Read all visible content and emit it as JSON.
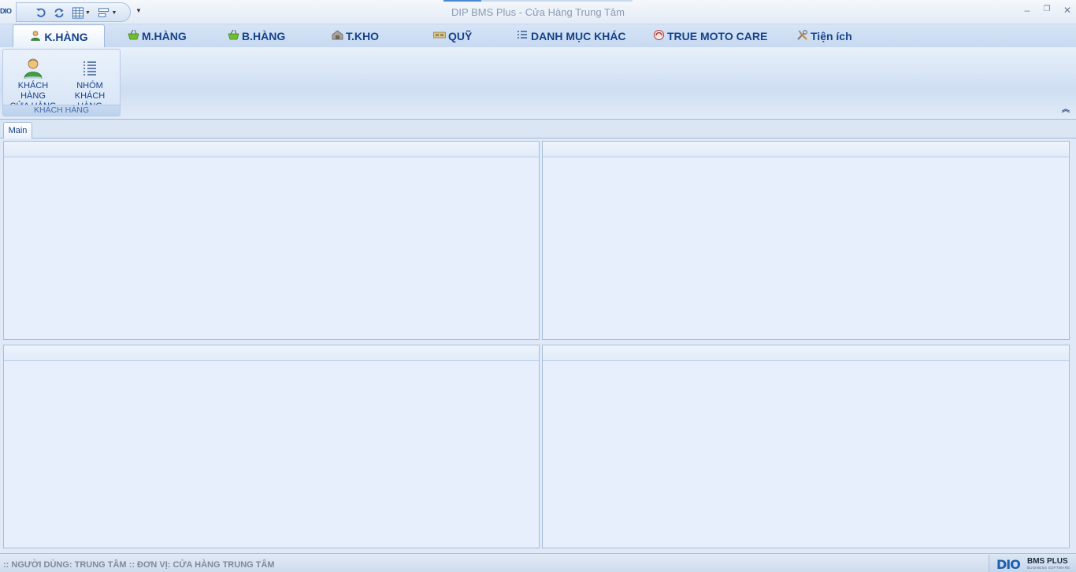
{
  "titlebar": {
    "app_logo_text": "DIO",
    "window_title": "DIP BMS Plus - Cửa Hàng Trung Tâm",
    "quick_access": [
      {
        "icon": "undo-icon"
      },
      {
        "icon": "refresh-icon"
      },
      {
        "icon": "grid-layout-icon"
      },
      {
        "icon": "list-layout-icon"
      }
    ],
    "controls": {
      "minimize": "–",
      "restore": "❐",
      "close": "✕"
    }
  },
  "ribbon": {
    "tabs": [
      {
        "label": "K.HÀNG",
        "icon": "customer-icon",
        "active": true
      },
      {
        "label": "M.HÀNG",
        "icon": "basket-icon"
      },
      {
        "label": "B.HÀNG",
        "icon": "basket-icon"
      },
      {
        "label": "T.KHO",
        "icon": "warehouse-icon"
      },
      {
        "label": "QUỸ",
        "icon": "cash-icon"
      },
      {
        "label": "DANH MỤC KHÁC",
        "icon": "list-icon"
      },
      {
        "label": "TRUE MOTO CARE",
        "icon": "moto-care-icon"
      },
      {
        "label": "Tiện ích",
        "icon": "tools-icon"
      }
    ],
    "group": {
      "caption": "KHÁCH HÀNG",
      "buttons": [
        {
          "line1": "KHÁCH HÀNG",
          "line2": "CỬA HÀNG",
          "icon": "customer-person-icon"
        },
        {
          "line1": "NHÓM KHÁCH",
          "line2": "HÀNG",
          "icon": "customer-group-list-icon"
        }
      ]
    }
  },
  "doc_tabs": [
    {
      "label": "Main",
      "active": true
    }
  ],
  "panels": [
    {
      "title": ""
    },
    {
      "title": ""
    },
    {
      "title": ""
    },
    {
      "title": ""
    }
  ],
  "statusbar": {
    "text": ":: NGƯỜI DÙNG: TRUNG TÂM   :: ĐƠN VỊ: CỬA HÀNG TRUNG TÂM",
    "brand_logo": "DIO",
    "brand_name": "BMS PLUS",
    "brand_sub": "BUSINESS SOFTWARE"
  },
  "colors": {
    "accent": "#15428b",
    "ribbon_bg": "#d6e4f6",
    "panel_bg": "#e6effb",
    "border": "#a8bedc"
  }
}
